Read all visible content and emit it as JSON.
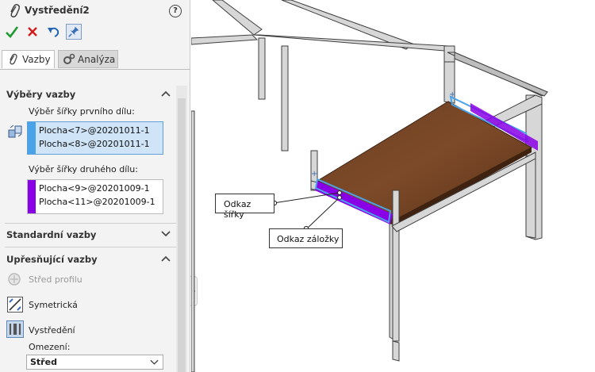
{
  "panel": {
    "title": "Vystředění2",
    "help_label": "?",
    "actions": [
      {
        "name": "ok",
        "icon": "checkmark-icon"
      },
      {
        "name": "cancel",
        "icon": "close-icon"
      },
      {
        "name": "undo",
        "icon": "undo-icon"
      },
      {
        "name": "pin",
        "icon": "pushpin-icon"
      }
    ],
    "tabs": [
      {
        "label": "Vazby",
        "icon": "paperclip-icon",
        "active": true
      },
      {
        "label": "Analýza",
        "icon": "gears-icon",
        "active": false
      }
    ],
    "selections": {
      "title": "Výběry vazby",
      "first_label": "Výběr šířky prvního dílu:",
      "first_items": [
        "Plocha<7>@20201011-1",
        "Plocha<8>@20201011-1"
      ],
      "first_color": "#4aa3e8",
      "second_label": "Výběr šířky druhého dílu:",
      "second_items": [
        "Plocha<9>@20201009-1",
        "Plocha<11>@20201009-1"
      ],
      "second_color": "#8a00e6"
    },
    "standard": {
      "title": "Standardní vazby"
    },
    "advanced": {
      "title": "Upřesňující vazby",
      "options": [
        {
          "label": "Střed profilu",
          "enabled": false
        },
        {
          "label": "Symetrická",
          "enabled": true
        },
        {
          "label": "Vystředění",
          "enabled": true,
          "selected": true
        }
      ],
      "constraint_label": "Omezení:",
      "constraint_value": "Střed"
    }
  },
  "viewport": {
    "callouts": [
      "Odkaz šířky",
      "Odkaz záložky"
    ]
  }
}
